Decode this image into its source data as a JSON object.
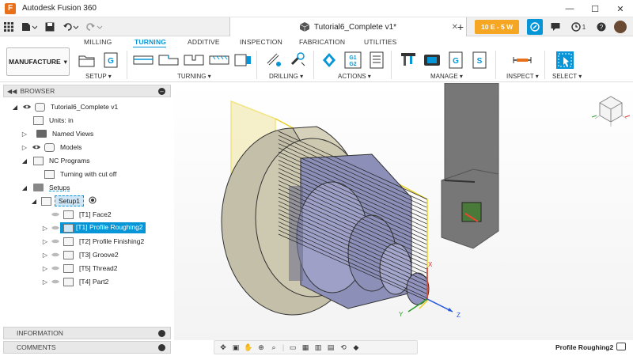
{
  "app": {
    "title": "Autodesk Fusion 360",
    "logo_letter": "F"
  },
  "document": {
    "tab_title": "Tutorial6_Complete v1*"
  },
  "job_status": "10 E - 5 W",
  "notifications_count": "1",
  "ribbon": {
    "tabs": [
      "MILLING",
      "TURNING",
      "ADDITIVE",
      "INSPECTION",
      "FABRICATION",
      "UTILITIES"
    ],
    "active_tab": "TURNING",
    "workspace": "MANUFACTURE",
    "groups": [
      "SETUP ▾",
      "TURNING ▾",
      "DRILLING ▾",
      "ACTIONS ▾",
      "MANAGE ▾",
      "INSPECT ▾",
      "SELECT ▾"
    ],
    "actions_g_label": "G1\nG2"
  },
  "browser": {
    "title": "BROWSER",
    "items": {
      "root": "Tutorial6_Complete v1",
      "units": "Units: in",
      "named_views": "Named Views",
      "models": "Models",
      "nc_programs": "NC Programs",
      "nc_program_item": "Turning with cut off",
      "setups": "Setups",
      "setup1": "Setup1",
      "op1": "[T1] Face2",
      "op2": "[T1] Profile Roughing2",
      "op3": "[T2] Profile Finishing2",
      "op4": "[T3] Groove2",
      "op5": "[T5] Thread2",
      "op6": "[T4] Part2"
    }
  },
  "panels": {
    "information": "INFORMATION",
    "comments": "COMMENTS"
  },
  "viewport": {
    "axis_x": "X",
    "axis_y": "Y",
    "axis_z": "Z"
  },
  "status": {
    "selected_operation": "Profile Roughing2"
  }
}
